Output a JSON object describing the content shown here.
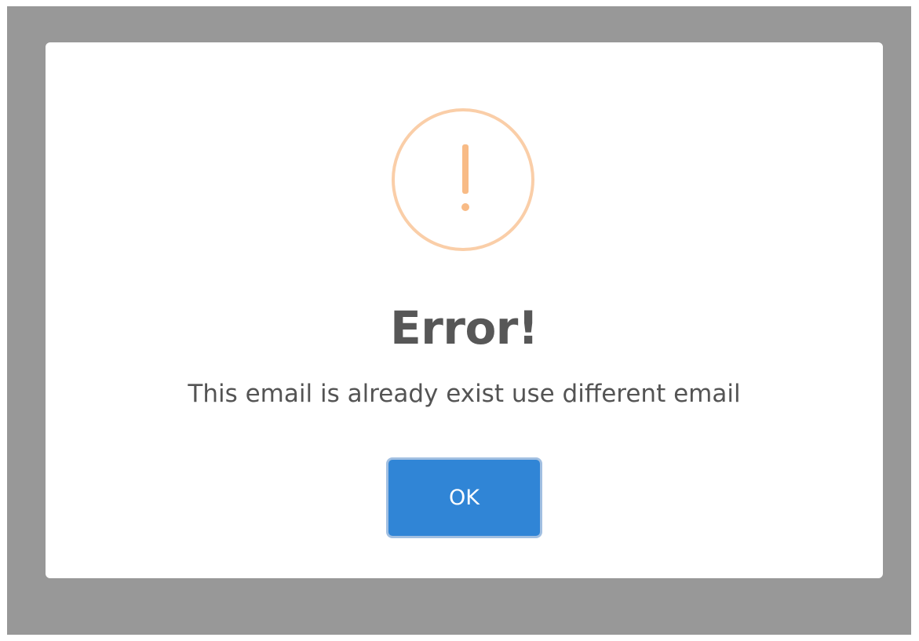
{
  "dialog": {
    "icon": "exclamation-warning-icon",
    "title": "Error!",
    "message": "This email is already exist use different email",
    "confirm_label": "OK"
  },
  "colors": {
    "backdrop": "#989898",
    "warning_ring": "#facea8",
    "warning_mark": "#f8bb86",
    "title_text": "#575757",
    "body_text": "#545454",
    "button_bg": "#3085d6",
    "button_text": "#ffffff"
  }
}
